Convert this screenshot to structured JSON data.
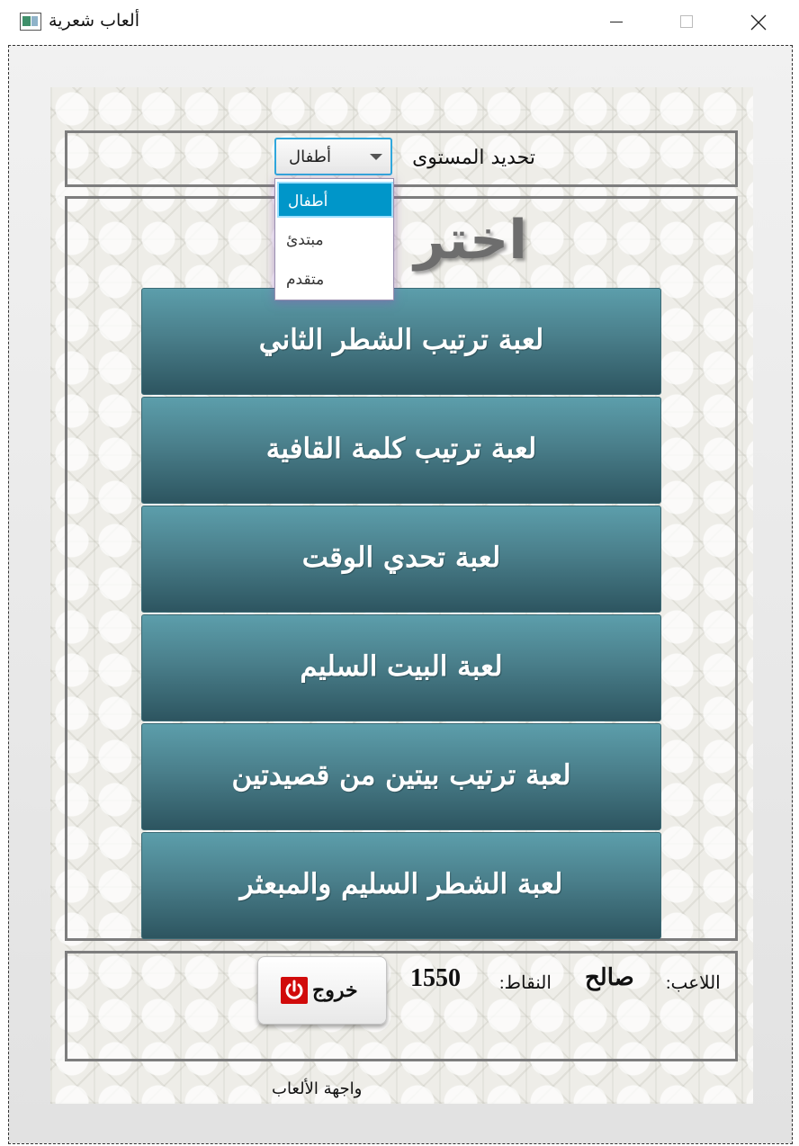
{
  "window": {
    "title": "ألعاب شعرية",
    "app_icon": "app-window-icon",
    "controls": [
      "minimize",
      "maximize",
      "close"
    ]
  },
  "level": {
    "label": "تحديد المستوى",
    "selected": "أطفال",
    "options": [
      "أطفال",
      "مبتدئ",
      "متقدم"
    ]
  },
  "main": {
    "heading": "اختر",
    "games": [
      "لعبة ترتيب الشطر الثاني",
      "لعبة ترتيب كلمة القافية",
      "لعبة تحدي الوقت",
      "لعبة البيت السليم",
      "لعبة ترتيب بيتين من قصيدتين",
      "لعبة الشطر السليم والمبعثر"
    ]
  },
  "status": {
    "player_label": "اللاعب:",
    "player_name": "صالح",
    "points_label": "النقاط:",
    "points_value": "1550",
    "exit_label": "خروج"
  },
  "footer": {
    "text": "واجهة الألعاب"
  },
  "colors": {
    "button_top": "#5c9eab",
    "button_bottom": "#2d5560",
    "selection": "#0096c9",
    "power": "#d10b0b"
  }
}
